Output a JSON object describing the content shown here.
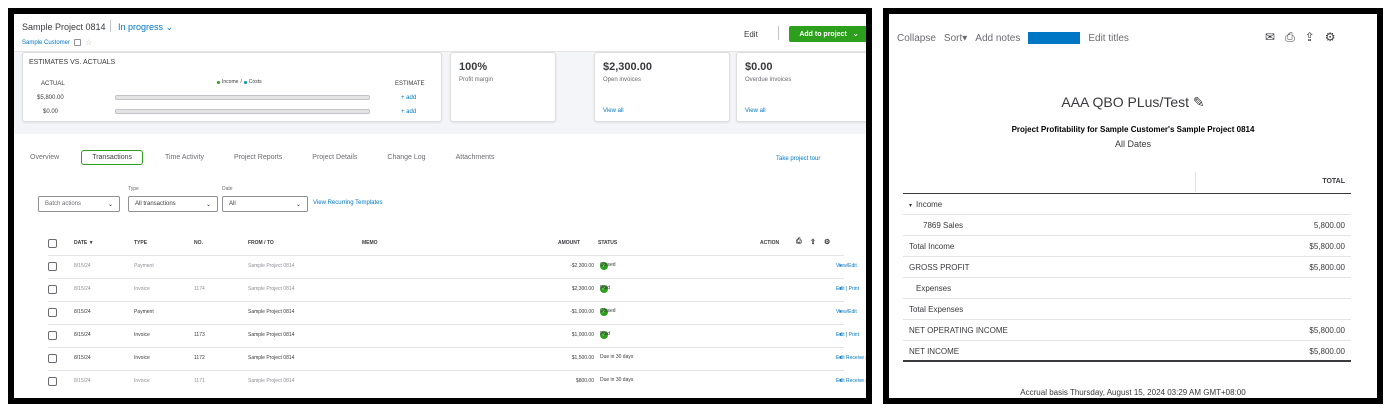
{
  "project": {
    "title": "Sample Project 0814",
    "status": "In progress",
    "subtitle": "Sample Customer",
    "edit_label": "Edit",
    "add_label": "Add to project"
  },
  "eva": {
    "title": "ESTIMATES VS. ACTUALS",
    "actual_header": "ACTUAL",
    "estimate_header": "ESTIMATE",
    "legend_income": "Income",
    "legend_costs": "Costs",
    "row1_value": "$5,800.00",
    "row2_value": "$0.00",
    "add_label": "+ add"
  },
  "kpis": [
    {
      "value": "100%",
      "label": "Profit margin",
      "link": ""
    },
    {
      "value": "$2,300.00",
      "label": "Open invoices",
      "link": "View all"
    },
    {
      "value": "$0.00",
      "label": "Overdue invoices",
      "link": "View all"
    }
  ],
  "tabs": [
    "Overview",
    "Transactions",
    "Time Activity",
    "Project Reports",
    "Project Details",
    "Change Log",
    "Attachments"
  ],
  "take_tour": "Take project tour",
  "filters": {
    "batch_label": "Batch actions",
    "type_label": "Type",
    "type_value": "All transactions",
    "date_label": "Date",
    "date_value": "All",
    "recurring_link": "View Recurring Templates"
  },
  "table": {
    "headers": {
      "date": "DATE ▼",
      "type": "TYPE",
      "no": "NO.",
      "fromto": "FROM / TO",
      "memo": "MEMO",
      "amount": "AMOUNT",
      "status": "STATUS",
      "action": "ACTION"
    },
    "rows": [
      {
        "date": "8/15/24",
        "type": "Payment",
        "no": "",
        "fromto": "Sample Project 0814",
        "amount": "-$2,300.00",
        "status": "Closed",
        "action": "View/Edit",
        "status_icon": "check",
        "clear": false
      },
      {
        "date": "8/15/24",
        "type": "Invoice",
        "no": "1174",
        "fromto": "Sample Project 0814",
        "amount": "$2,300.00",
        "status": "Paid",
        "action": "Edit | Print",
        "status_icon": "check",
        "clear": false
      },
      {
        "date": "8/15/24",
        "type": "Payment",
        "no": "",
        "fromto": "Sample Project 0814",
        "amount": "-$1,000.00",
        "status": "Closed",
        "action": "View/Edit",
        "status_icon": "check",
        "clear": true
      },
      {
        "date": "8/15/24",
        "type": "Invoice",
        "no": "1173",
        "fromto": "Sample Project 0814",
        "amount": "$1,000.00",
        "status": "Paid",
        "action": "Edit | Print",
        "status_icon": "check",
        "clear": true
      },
      {
        "date": "8/15/24",
        "type": "Invoice",
        "no": "1172",
        "fromto": "Sample Project 0814",
        "amount": "$1,500.00",
        "status": "Due in 30 days",
        "action": "Edit   Receive payment",
        "status_icon": "",
        "clear": true
      },
      {
        "date": "8/15/24",
        "type": "Invoice",
        "no": "1171",
        "fromto": "Sample Project 0814",
        "amount": "$800.00",
        "status": "Due in 30 days",
        "action": "Edit   Receive payment",
        "status_icon": "",
        "clear": false
      }
    ]
  },
  "report": {
    "toolbar": [
      "Collapse",
      "Sort",
      "Add notes",
      "Edit titles"
    ],
    "company": "AAA QBO PLus/Test",
    "title": "Project Profitability for Sample Customer's Sample Project 0814",
    "dates": "All Dates",
    "total_header": "TOTAL",
    "rows": [
      {
        "label": "Income",
        "value": "",
        "indent": 0,
        "caret": true
      },
      {
        "label": "7869 Sales",
        "value": "5,800.00",
        "indent": 2,
        "caret": false
      },
      {
        "label": "Total Income",
        "value": "$5,800.00",
        "indent": 0,
        "caret": false
      },
      {
        "label": "GROSS PROFIT",
        "value": "$5,800.00",
        "indent": 0,
        "caret": false
      },
      {
        "label": "Expenses",
        "value": "",
        "indent": 1,
        "caret": false
      },
      {
        "label": "Total Expenses",
        "value": "",
        "indent": 0,
        "caret": false
      },
      {
        "label": "NET OPERATING INCOME",
        "value": "$5,800.00",
        "indent": 0,
        "caret": false
      },
      {
        "label": "NET INCOME",
        "value": "$5,800.00",
        "indent": 0,
        "caret": false
      }
    ],
    "footer": "Accrual basis  Thursday, August 15, 2024  03:29 AM GMT+08:00"
  },
  "colors": {
    "green": "#2ca01c",
    "blue": "#0077c5",
    "income": "#2ca01c",
    "costs": "#0097a7"
  }
}
